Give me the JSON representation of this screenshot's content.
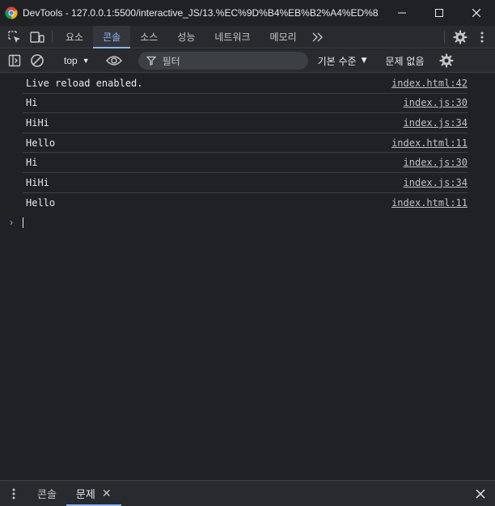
{
  "window": {
    "title": "DevTools - 127.0.0.1:5500/interactive_JS/13.%EC%9D%B4%EB%B2%A4%ED%8A..."
  },
  "tabs": [
    {
      "label": "요소"
    },
    {
      "label": "콘솔",
      "active": true
    },
    {
      "label": "소스"
    },
    {
      "label": "성능"
    },
    {
      "label": "네트워크"
    },
    {
      "label": "메모리"
    }
  ],
  "toolbar": {
    "context": "top",
    "filter_placeholder": "필터",
    "levels": "기본 수준",
    "issues": "문제 없음"
  },
  "console": {
    "messages": [
      {
        "text": "Live reload enabled.",
        "source": "index.html:42"
      },
      {
        "text": "Hi",
        "source": "index.js:30"
      },
      {
        "text": "HiHi",
        "source": "index.js:34"
      },
      {
        "text": "Hello",
        "source": "index.html:11"
      },
      {
        "text": "Hi",
        "source": "index.js:30"
      },
      {
        "text": "HiHi",
        "source": "index.js:34"
      },
      {
        "text": "Hello",
        "source": "index.html:11"
      }
    ]
  },
  "drawer": {
    "tabs": [
      {
        "label": "콘솔"
      },
      {
        "label": "문제",
        "active": true
      }
    ]
  },
  "colors": {
    "background": "#202124",
    "toolbar": "#292a2d",
    "accent": "#8ab4f8"
  }
}
